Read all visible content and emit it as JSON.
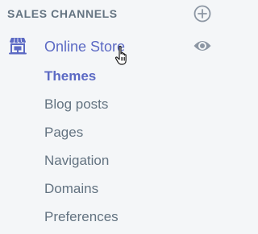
{
  "sidebar": {
    "section": {
      "title": "SALES CHANNELS",
      "add_icon": "plus-circle-icon"
    },
    "channel": {
      "label": "Online Store",
      "icon": "storefront-icon",
      "view_icon": "eye-icon"
    },
    "sub_items": [
      {
        "label": "Themes",
        "active": true
      },
      {
        "label": "Blog posts",
        "active": false
      },
      {
        "label": "Pages",
        "active": false
      },
      {
        "label": "Navigation",
        "active": false
      },
      {
        "label": "Domains",
        "active": false
      },
      {
        "label": "Preferences",
        "active": false
      }
    ]
  },
  "colors": {
    "background": "#f4f6f8",
    "accent": "#5c6ac4",
    "muted_text": "#637381",
    "icon_gray": "#8c96a3"
  },
  "cursor": "hand-pointer-cursor"
}
